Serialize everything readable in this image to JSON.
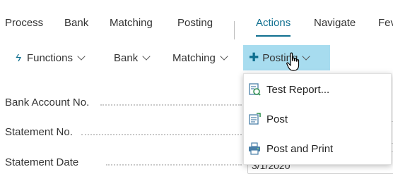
{
  "top_tabs": [
    {
      "label": "Process"
    },
    {
      "label": "Bank"
    },
    {
      "label": "Matching"
    },
    {
      "label": "Posting"
    },
    {
      "label": "Actions"
    },
    {
      "label": "Navigate"
    },
    {
      "label": "Fev"
    }
  ],
  "sub_actions": {
    "functions": "Functions",
    "bank": "Bank",
    "matching": "Matching",
    "posting": "Posting"
  },
  "posting_menu": [
    {
      "label": "Test Report...",
      "icon": "test-report-icon"
    },
    {
      "label": "Post",
      "icon": "post-icon"
    },
    {
      "label": "Post and Print",
      "icon": "post-and-print-icon"
    }
  ],
  "fields": [
    {
      "label": "Bank Account No.",
      "value": ""
    },
    {
      "label": "Statement No.",
      "value": ""
    },
    {
      "label": "Statement Date",
      "value": "3/1/2020"
    }
  ],
  "colors": {
    "accent": "#0f6f8f",
    "selected_bg": "#a7dcef"
  }
}
